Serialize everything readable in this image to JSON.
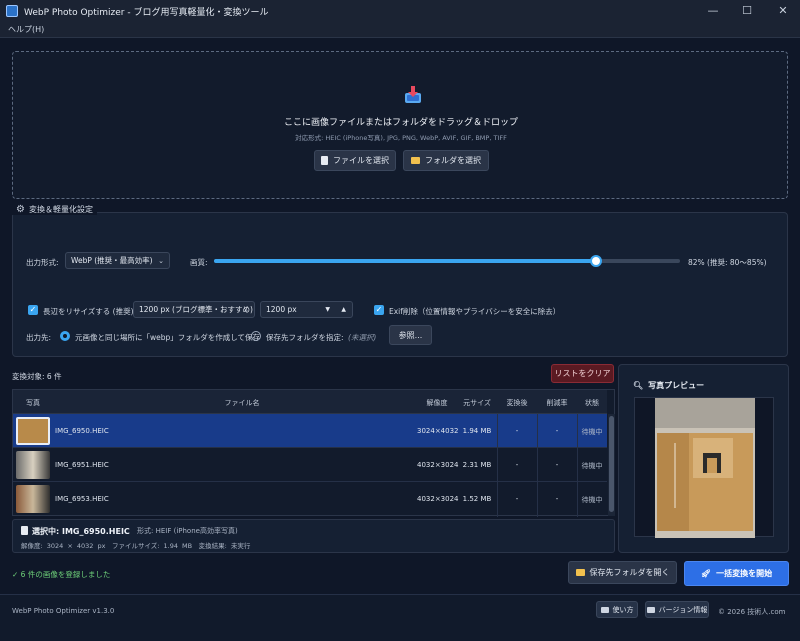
{
  "window": {
    "title": "WebP Photo Optimizer - ブログ用写真軽量化・変換ツール",
    "menu": [
      "ヘルプ(H)"
    ]
  },
  "dropzone": {
    "title": "ここに画像ファイルまたはフォルダをドラッグ＆ドロップ",
    "formats": "対応形式: HEIC (iPhone写真), JPG, PNG, WebP, AVIF, GIF, BMP, TIFF",
    "select_file": "ファイルを選択",
    "select_folder": "フォルダを選択"
  },
  "settings": {
    "title": "変換＆軽量化設定",
    "output_format_label": "出力形式:",
    "output_format_value": "WebP (推奨・最高効率)",
    "quality_label": "画質:",
    "quality_value": 82,
    "quality_text": "82% (推奨: 80〜85%)",
    "resize_label": "長辺をリサイズする (推奨)",
    "resize_checked": true,
    "resize_preset": "1200 px (ブログ標準・おすすめ)",
    "resize_px": "1200 px",
    "exif_label": "Exif削除（位置情報やプライバシーを安全に除去）",
    "exif_checked": true,
    "output_dest_label": "出力先:",
    "dest_option_1": "元画像と同じ場所に「webp」フォルダを作成して保存",
    "dest_option_2": "保存先フォルダを指定:",
    "dest_unselected": "(未選択)",
    "browse_button": "参照..."
  },
  "list": {
    "count_label": "変換対象: 6 件",
    "clear_button": "リストをクリア",
    "columns": [
      "写真",
      "ファイル名",
      "解像度",
      "元サイズ",
      "変換後",
      "削減率",
      "状態"
    ],
    "rows": [
      {
        "name": "IMG_6950.HEIC",
        "res": "3024×4032",
        "size": "1.94 MB",
        "after": "-",
        "rate": "-",
        "status": "待機中"
      },
      {
        "name": "IMG_6951.HEIC",
        "res": "4032×3024",
        "size": "2.31 MB",
        "after": "-",
        "rate": "-",
        "status": "待機中"
      },
      {
        "name": "IMG_6953.HEIC",
        "res": "4032×3024",
        "size": "1.52 MB",
        "after": "-",
        "rate": "-",
        "status": "待機中"
      }
    ]
  },
  "info": {
    "selected": "選択中: IMG_6950.HEIC",
    "format": "形式: HEIF (iPhone高効率写真)",
    "meta": "解像度: 3024 × 4032 px　ファイルサイズ: 1.94 MB　変換結果: 未実行"
  },
  "preview": {
    "title": "写真プレビュー"
  },
  "actions": {
    "status_msg": "✓ 6 件の画像を登録しました",
    "open_folder": "保存先フォルダを開く",
    "start": "一括変換を開始"
  },
  "footer": {
    "version": "WebP Photo Optimizer v1.3.0",
    "howto": "使い方",
    "version_info": "バージョン情報",
    "copyright": "© 2026 技術人.com"
  },
  "colors": {
    "accent": "#3aa5f0",
    "primary_button": "#2d6fe6",
    "danger": "#5a1a22",
    "success": "#6fd27a"
  }
}
